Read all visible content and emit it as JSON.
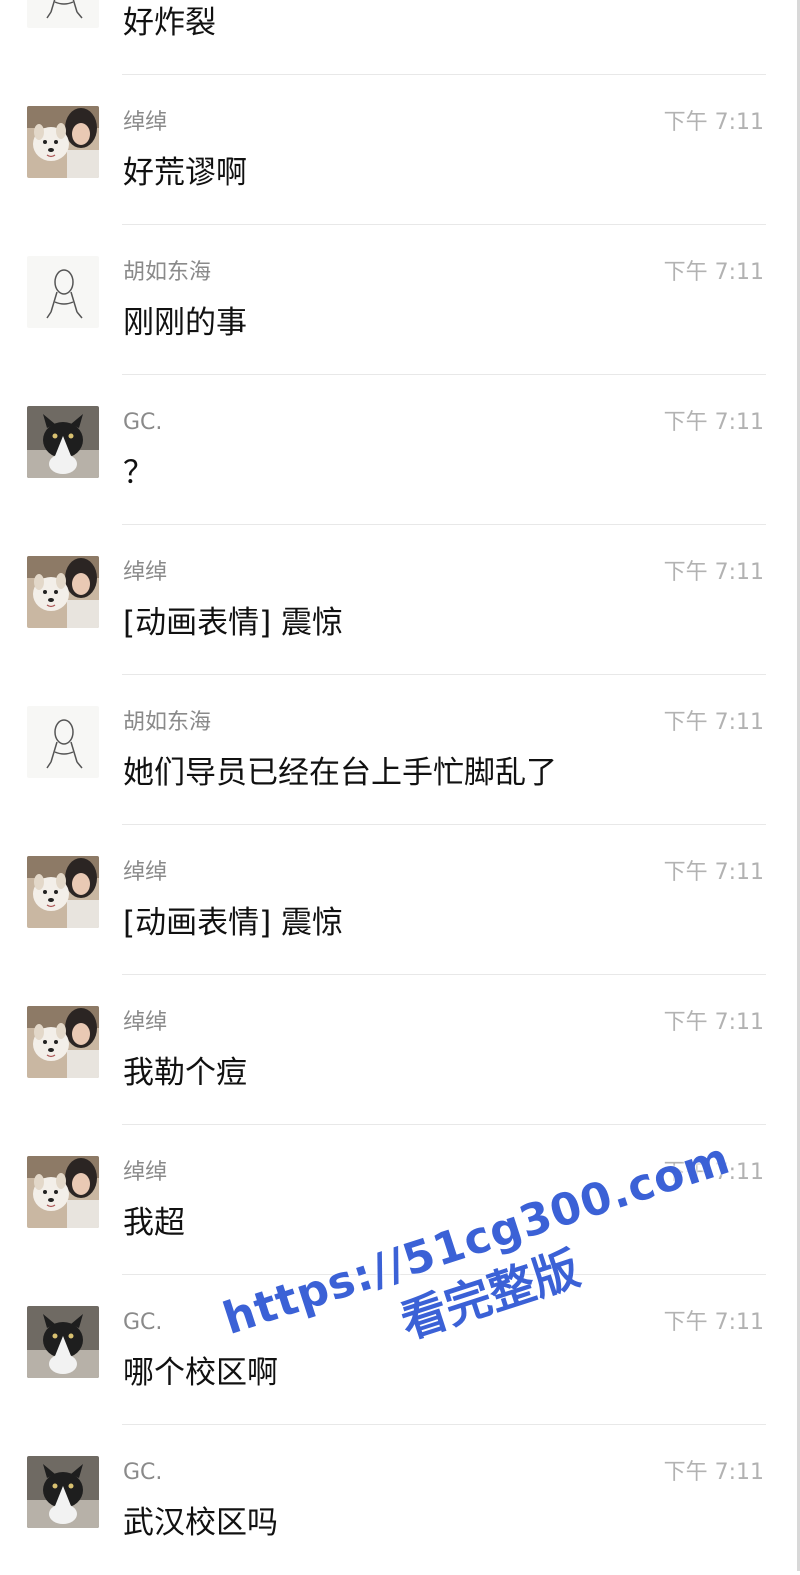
{
  "messages": [
    {
      "sender": "",
      "time": "",
      "text": "好炸裂",
      "avatar": "sketch-avatar"
    },
    {
      "sender": "绰绰",
      "time": "下午 7:11",
      "text": "好荒谬啊",
      "avatar": "dog-girl-avatar"
    },
    {
      "sender": "胡如东海",
      "time": "下午 7:11",
      "text": "刚刚的事",
      "avatar": "sketch-avatar"
    },
    {
      "sender": "GC.",
      "time": "下午 7:11",
      "text": "？",
      "avatar": "cat-avatar"
    },
    {
      "sender": "绰绰",
      "time": "下午 7:11",
      "text": "[动画表情] 震惊",
      "avatar": "dog-girl-avatar"
    },
    {
      "sender": "胡如东海",
      "time": "下午 7:11",
      "text": "她们导员已经在台上手忙脚乱了",
      "avatar": "sketch-avatar"
    },
    {
      "sender": "绰绰",
      "time": "下午 7:11",
      "text": "[动画表情] 震惊",
      "avatar": "dog-girl-avatar"
    },
    {
      "sender": "绰绰",
      "time": "下午 7:11",
      "text": "我勒个痘",
      "avatar": "dog-girl-avatar"
    },
    {
      "sender": "绰绰",
      "time": "下午 7:11",
      "text": "我超",
      "avatar": "dog-girl-avatar"
    },
    {
      "sender": "GC.",
      "time": "下午 7:11",
      "text": "哪个校区啊",
      "avatar": "cat-avatar"
    },
    {
      "sender": "GC.",
      "time": "下午 7:11",
      "text": "武汉校区吗",
      "avatar": "cat-avatar"
    }
  ],
  "watermark": {
    "url": "https://51cg300.com",
    "text": "看完整版"
  }
}
